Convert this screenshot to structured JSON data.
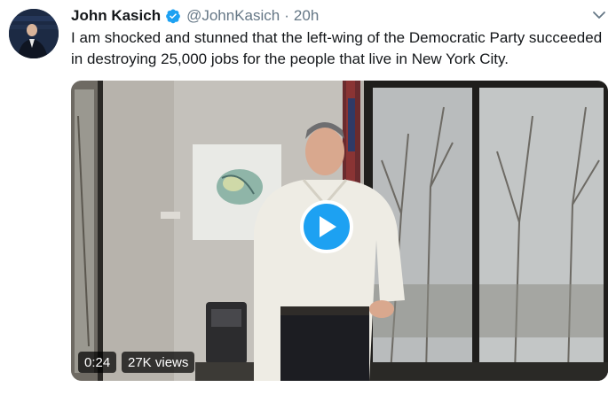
{
  "tweet": {
    "author_name": "John Kasich",
    "handle": "@JohnKasich",
    "separator": "·",
    "time": "20h",
    "text": "I am shocked and stunned that the left-wing of the Democratic Party succeeded\nin destroying 25,000 jobs for the people that live in New York City."
  },
  "video": {
    "duration": "0:24",
    "views": "27K views"
  },
  "colors": {
    "verified": "#1da1f2",
    "play_button": "#1da1f2",
    "secondary_text": "#657786"
  },
  "icons": {
    "verified": "verified-badge-icon",
    "menu": "chevron-down-icon",
    "play": "play-icon"
  }
}
